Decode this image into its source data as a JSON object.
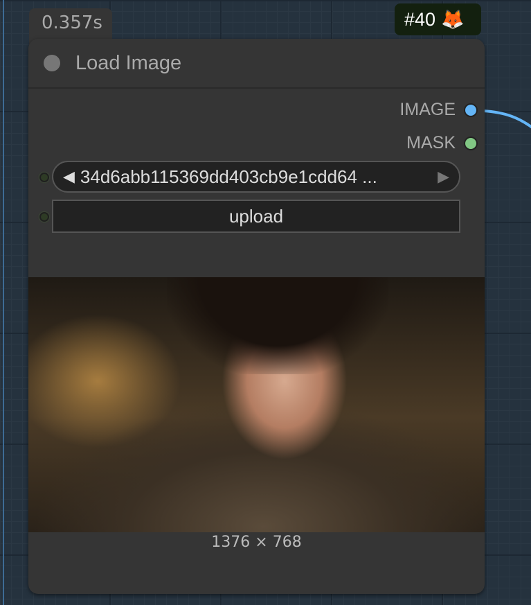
{
  "timing": "0.357s",
  "node_badge": {
    "id": "#40",
    "emoji": "🦊"
  },
  "node": {
    "title": "Load Image",
    "outputs": [
      {
        "label": "IMAGE",
        "color": "#64b5f6"
      },
      {
        "label": "MASK",
        "color": "#81c784"
      }
    ],
    "image_combo": {
      "value": "34d6abb115369dd403cb9e1cdd64 ...",
      "prev": "◀",
      "next": "▶"
    },
    "upload_label": "upload",
    "image_dimensions": "1376 × 768"
  }
}
